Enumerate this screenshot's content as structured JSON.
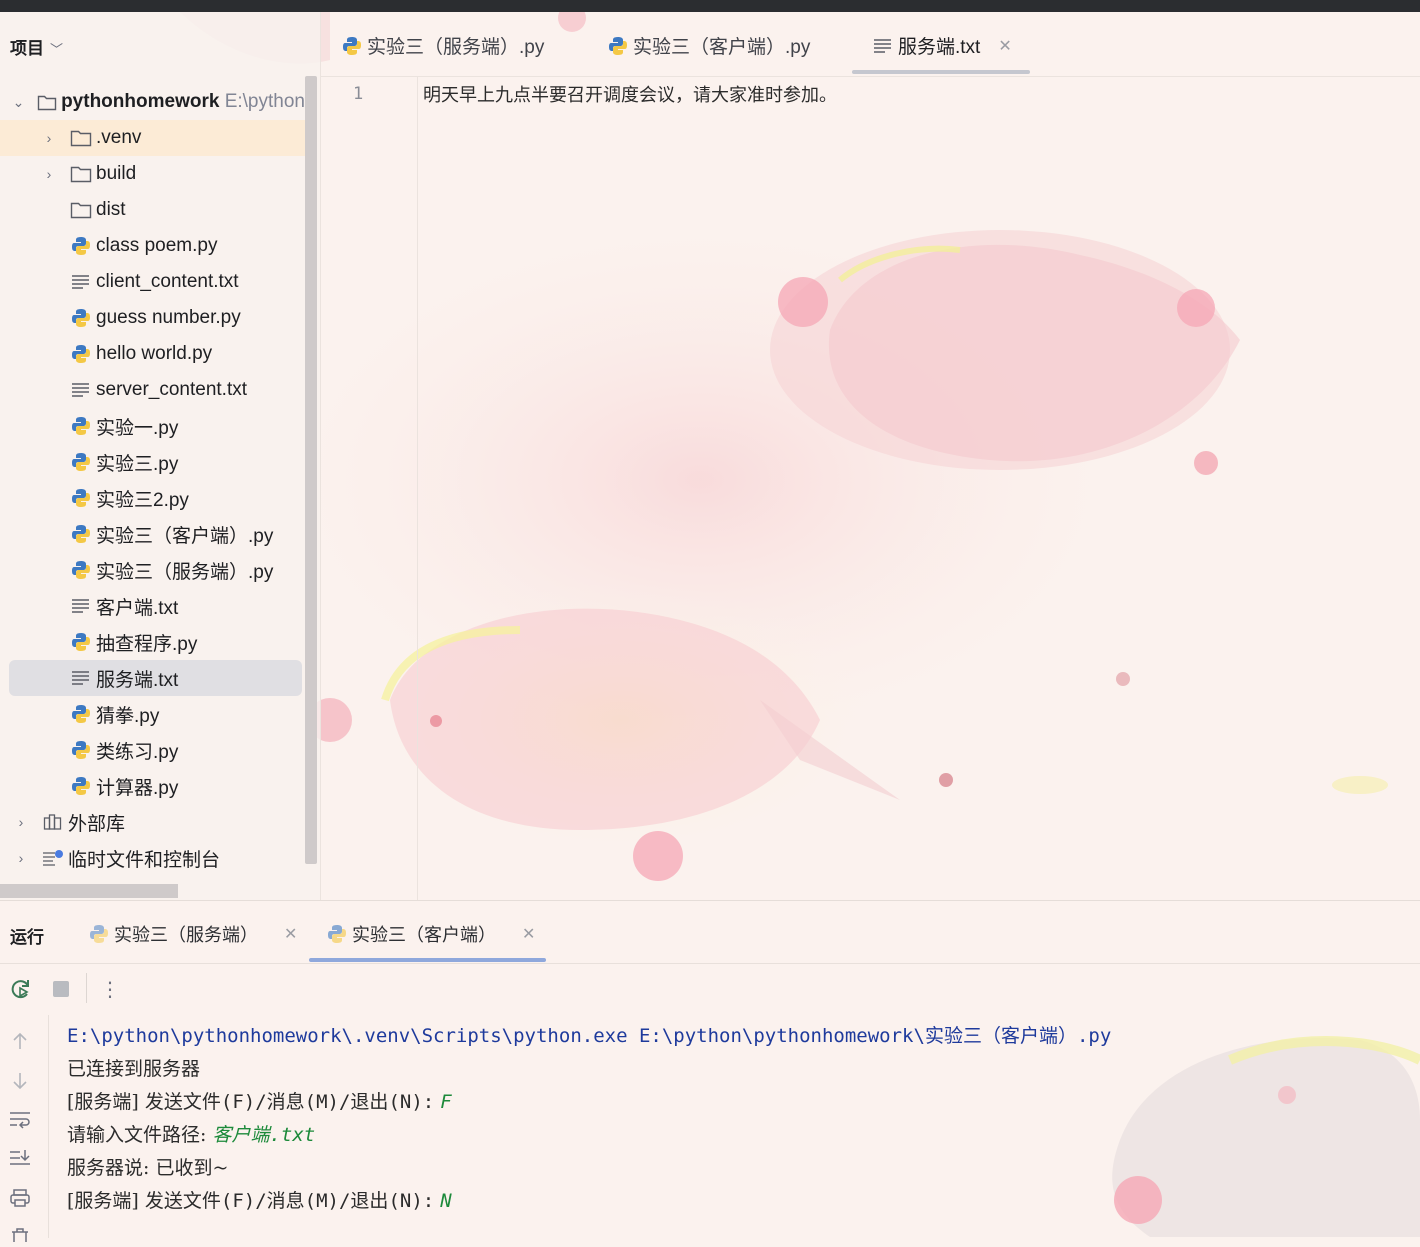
{
  "project_panel": {
    "title": "项目",
    "root": {
      "name": "pythonhomework",
      "path": "E:\\python"
    },
    "items": [
      {
        "name": ".venv",
        "type": "folder",
        "expandable": true
      },
      {
        "name": "build",
        "type": "folder",
        "expandable": true
      },
      {
        "name": "dist",
        "type": "folder",
        "expandable": false
      },
      {
        "name": "class poem.py",
        "type": "python"
      },
      {
        "name": "client_content.txt",
        "type": "text"
      },
      {
        "name": "guess number.py",
        "type": "python"
      },
      {
        "name": "hello world.py",
        "type": "python"
      },
      {
        "name": "server_content.txt",
        "type": "text"
      },
      {
        "name": "实验一.py",
        "type": "python"
      },
      {
        "name": "实验三.py",
        "type": "python"
      },
      {
        "name": "实验三2.py",
        "type": "python"
      },
      {
        "name": "实验三（客户端）.py",
        "type": "python"
      },
      {
        "name": "实验三（服务端）.py",
        "type": "python"
      },
      {
        "name": "客户端.txt",
        "type": "text"
      },
      {
        "name": "抽查程序.py",
        "type": "python"
      },
      {
        "name": "服务端.txt",
        "type": "text",
        "selected": true
      },
      {
        "name": "猜拳.py",
        "type": "python"
      },
      {
        "name": "类练习.py",
        "type": "python"
      },
      {
        "name": "计算器.py",
        "type": "python"
      }
    ],
    "external_libs": "外部库",
    "scratches": "临时文件和控制台"
  },
  "editor": {
    "tabs": [
      {
        "label": "实验三（服务端）.py",
        "icon": "python-icon"
      },
      {
        "label": "实验三（客户端）.py",
        "icon": "python-icon"
      },
      {
        "label": "服务端.txt",
        "icon": "text-file-icon",
        "active": true
      }
    ],
    "line_number": "1",
    "line_text": "明天早上九点半要召开调度会议，请大家准时参加。"
  },
  "run_panel": {
    "title": "运行",
    "tabs": [
      {
        "label": "实验三（服务端）"
      },
      {
        "label": "实验三（客户端）",
        "active": true
      }
    ],
    "console": {
      "line1_path": "E:\\python\\pythonhomework\\.venv\\Scripts\\python.exe E:\\python\\pythonhomework\\",
      "line1_file": "实验三（客户端）",
      "line1_ext": ".py",
      "line2": "已连接到服务器",
      "line3_prefix": "[服务端] 发送文件",
      "line3_opts": "(F)/",
      "line3_mid": "消息",
      "line3_opts2": "(M)/",
      "line3_mid2": "退出",
      "line3_opts3": "(N):",
      "line3_input": "F",
      "line4_prompt": "请输入文件路径: ",
      "line4_input_cn": "客户端",
      "line4_input_ext": ".txt",
      "line5": "服务器说: 已收到~",
      "line6_input": "N"
    }
  },
  "colors": {
    "accent": "#8fa8dc",
    "console_input": "#1d8a3b",
    "console_path": "#1e3a9c"
  }
}
